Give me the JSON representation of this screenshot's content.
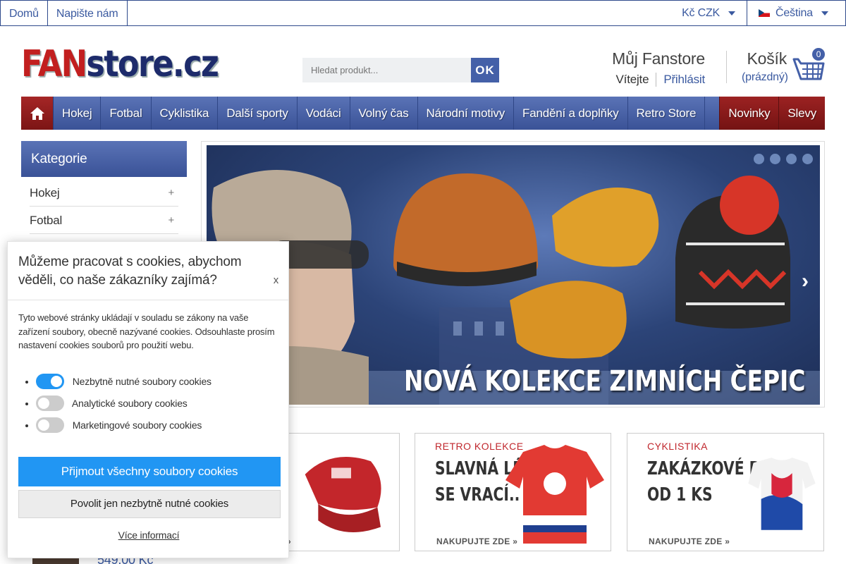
{
  "topbar": {
    "home": "Domů",
    "contact": "Napište nám",
    "currency": "Kč CZK",
    "language": "Čeština"
  },
  "logo": {
    "part1": "FAN",
    "part2": "store.cz"
  },
  "search": {
    "placeholder": "Hledat produkt...",
    "button": "OK"
  },
  "account": {
    "title": "Můj Fanstore",
    "welcome": "Vítejte",
    "login": "Přihlásit"
  },
  "cart": {
    "title": "Košík",
    "status": "(prázdný)",
    "count": "0"
  },
  "nav": {
    "items": [
      "Hokej",
      "Fotbal",
      "Cyklistika",
      "Další sporty",
      "Vodáci",
      "Volný čas",
      "Národní motivy",
      "Fandění a doplňky",
      "Retro Store"
    ],
    "new": "Novinky",
    "sale": "Slevy"
  },
  "sidebar": {
    "title": "Kategorie",
    "items": [
      {
        "label": "Hokej",
        "expand": "+"
      },
      {
        "label": "Fotbal",
        "expand": "+"
      }
    ]
  },
  "slider": {
    "caption": "NOVÁ KOLEKCE ZIMNÍCH ČEPIC",
    "next": "›"
  },
  "promos": [
    {
      "tag": "RETRO KOLEKCE",
      "line1": "SLAVNÁ LÉTA",
      "line2": "SE VRACÍ..",
      "cta": "NAKUPUJTE ZDE »"
    },
    {
      "tag": "CYKLISTIKA",
      "line1": "ZAKÁZKOVÉ DRESY",
      "line2": "OD 1 KS",
      "cta": "NAKUPUJTE ZDE »"
    }
  ],
  "product": {
    "price": "549,00 Kč"
  },
  "cookies": {
    "heading": "Můžeme pracovat s cookies, abychom věděli, co naše zákazníky zajímá?",
    "close": "x",
    "text": "Tyto webové stránky ukládají v souladu se zákony na vaše zařízení soubory, obecně nazývané cookies. Odsouhlaste prosím nastavení cookies souborů pro použití webu.",
    "options": [
      {
        "label": "Nezbytně nutné soubory cookies",
        "enabled": true
      },
      {
        "label": "Analytické soubory cookies",
        "enabled": false
      },
      {
        "label": "Marketingové soubory cookies",
        "enabled": false
      }
    ],
    "accept_all": "Přijmout všechny soubory cookies",
    "necessary_only": "Povolit jen nezbytně nutné cookies",
    "more": "Více informací"
  },
  "colors": {
    "brand_blue": "#3b5aa0",
    "brand_red": "#9c2222",
    "cookie_blue": "#2196f3"
  }
}
